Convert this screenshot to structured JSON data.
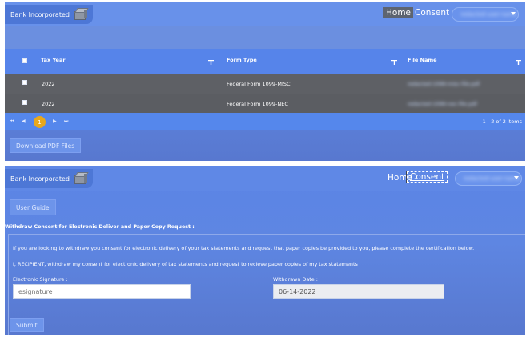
{
  "brand": {
    "name": "Bank Incorporated",
    "logo_icon": "box-icon"
  },
  "nav": {
    "home": "Home",
    "consent": "Consent",
    "user_menu": "redacted-user-name"
  },
  "grid": {
    "columns": [
      "Tax Year",
      "Form Type",
      "File Name"
    ],
    "rows": [
      {
        "tax_year": "2022",
        "form_type": "Federal Form 1099-MISC",
        "file_name": "redacted-1099-misc-file.pdf"
      },
      {
        "tax_year": "2022",
        "form_type": "Federal Form 1099-NEC",
        "file_name": "redacted-1099-nec-file.pdf"
      }
    ],
    "pager": {
      "first": "⏮",
      "prev": "◀",
      "current_page": "1",
      "next": "▶",
      "last": "⏭",
      "info": "1 - 2 of 2 items"
    }
  },
  "download_button": "Download PDF Files",
  "consent_form": {
    "user_guide_button": "User Guide",
    "title": "Withdraw Consent for Electronic Deliver and Paper Copy Request :",
    "intro": "If you are looking to withdraw you consent for electronic delivery of your tax statements and request that paper copies be provided to you, please complete the certification below.",
    "certification": "I, RECIPIENT, withdraw my consent for electronic delivery of tax statements and request to recieve paper copies of my tax statements",
    "signature_label": "Electronic Signature :",
    "signature_placeholder": "esignature",
    "date_label": "Withdrawn Date :",
    "date_value": "06-14-2022",
    "submit_button": "Submit"
  },
  "colors": {
    "header": "#5b84e6",
    "row_bg": "#5e6065",
    "pager_active": "#e8a81c"
  }
}
